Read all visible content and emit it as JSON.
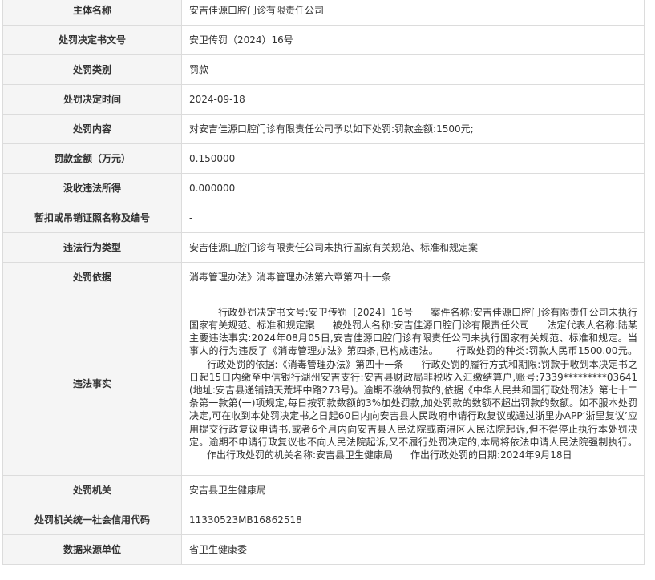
{
  "rows": [
    {
      "label": "主体名称",
      "value": "安吉佳源口腔门诊有限责任公司"
    },
    {
      "label": "处罚决定书文号",
      "value": "安卫传罚（2024）16号"
    },
    {
      "label": "处罚类别",
      "value": "罚款"
    },
    {
      "label": "处罚决定时间",
      "value": "2024-09-18"
    },
    {
      "label": "处罚内容",
      "value": "对安吉佳源口腔门诊有限责任公司予以如下处罚:罚款金额:1500元;"
    },
    {
      "label": "罚款金额（万元）",
      "value": "0.150000"
    },
    {
      "label": "没收违法所得",
      "value": "0.000000"
    },
    {
      "label": "暂扣或吊销证照名称及编号",
      "value": "-"
    },
    {
      "label": "违法行为类型",
      "value": "安吉佳源口腔门诊有限责任公司未执行国家有关规范、标准和规定案"
    },
    {
      "label": "处罚依据",
      "value": "消毒管理办法》消毒管理办法第六章第四十一条"
    }
  ],
  "facts": {
    "label": "违法事实",
    "segments": [
      "行政处罚决定书文号:安卫传罚〔2024〕16号",
      "案件名称:安吉佳源口腔门诊有限责任公司未执行国家有关规范、标准和规定案",
      "被处罚人名称:安吉佳源口腔门诊有限责任公司",
      "法定代表人名称:陆某",
      "主要违法事实:2024年08月05日,安吉佳源口腔门诊有限责任公司未执行国家有关规范、标准和规定。当事人的行为违反了《消毒管理办法》第四条,已构成违法。",
      "行政处罚的种类:罚款人民币1500.00元。",
      "行政处罚的依据:《消毒管理办法》第四十一条",
      "行政处罚的履行方式和期限:罚款于收到本决定书之日起15日内缴至中信银行湖州安吉支行:安吉县财政局非税收入汇缴结算户,账号:7339*********03641(地址:安吉县递铺镇天荒坪中路273号)。逾期不缴纳罚款的,依据《中华人民共和国行政处罚法》第七十二条第一款第(一)项规定,每日按罚款数额的3%加处罚款,加处罚款的数额不超出罚款的数额。如不服本处罚决定,可在收到本处罚决定书之日起60日内向安吉县人民政府申请行政复议或通过浙里办APP‘浙里复议’应用提交行政复议申请书,或者6个月内向安吉县人民法院或南浔区人民法院起诉,但不得停止执行本处罚决定。逾期不申请行政复议也不向人民法院起诉,又不履行处罚决定的,本局将依法申请人民法院强制执行。",
      "作出行政处罚的机关名称:安吉县卫生健康局",
      "作出行政处罚的日期:2024年9月18日"
    ]
  },
  "rows_after": [
    {
      "label": "处罚机关",
      "value": "安吉县卫生健康局"
    },
    {
      "label": "处罚机关统一社会信用代码",
      "value": "11330523MB16862518"
    },
    {
      "label": "数据来源单位",
      "value": "省卫生健康委"
    }
  ]
}
